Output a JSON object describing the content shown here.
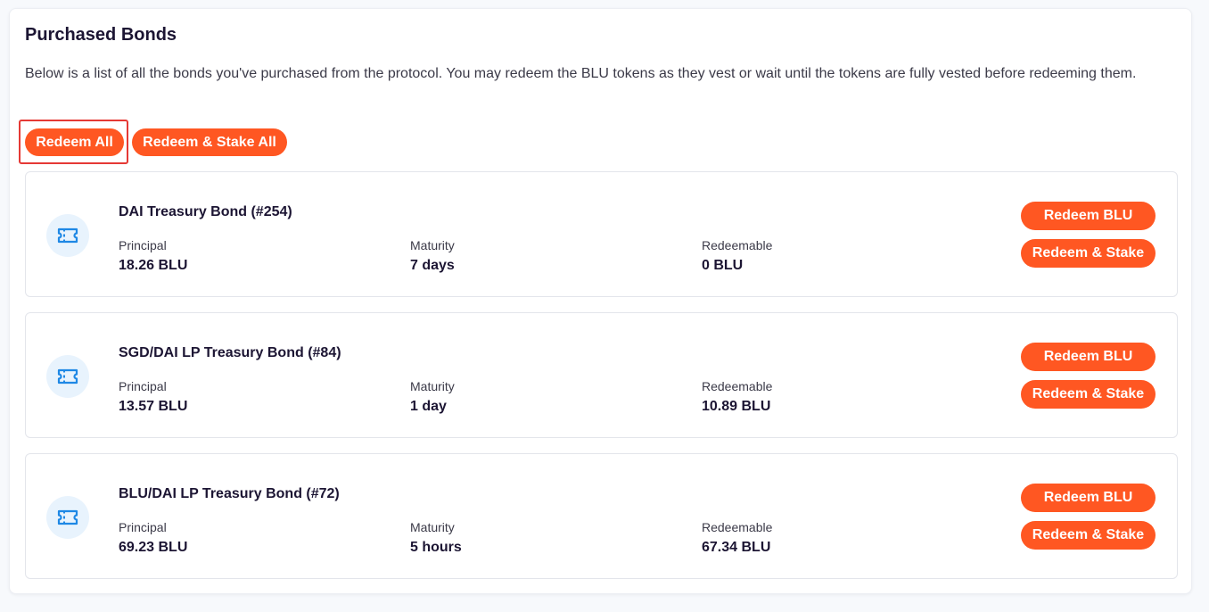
{
  "header": {
    "title": "Purchased Bonds",
    "description": "Below is a list of all the bonds you've purchased from the protocol. You may redeem the BLU tokens as they vest or wait until the tokens are fully vested before redeeming them."
  },
  "actions": {
    "redeem_all": "Redeem All",
    "redeem_stake_all": "Redeem & Stake All"
  },
  "colors": {
    "accent": "#ff5722",
    "icon": "#1e88e5",
    "icon_bg": "#e8f3fd",
    "highlight": "#e53935"
  },
  "bonds": [
    {
      "icon": "ticket-icon",
      "name": "DAI Treasury Bond (#254)",
      "principal_label": "Principal",
      "principal": "18.26 BLU",
      "maturity_label": "Maturity",
      "maturity": "7 days",
      "redeemable_label": "Redeemable",
      "redeemable": "0 BLU",
      "redeem_label": "Redeem BLU",
      "redeem_stake_label": "Redeem & Stake"
    },
    {
      "icon": "ticket-icon",
      "name": "SGD/DAI LP Treasury Bond (#84)",
      "principal_label": "Principal",
      "principal": "13.57 BLU",
      "maturity_label": "Maturity",
      "maturity": "1 day",
      "redeemable_label": "Redeemable",
      "redeemable": "10.89 BLU",
      "redeem_label": "Redeem BLU",
      "redeem_stake_label": "Redeem & Stake"
    },
    {
      "icon": "ticket-icon",
      "name": "BLU/DAI LP Treasury Bond (#72)",
      "principal_label": "Principal",
      "principal": "69.23 BLU",
      "maturity_label": "Maturity",
      "maturity": "5 hours",
      "redeemable_label": "Redeemable",
      "redeemable": "67.34 BLU",
      "redeem_label": "Redeem BLU",
      "redeem_stake_label": "Redeem & Stake"
    }
  ]
}
